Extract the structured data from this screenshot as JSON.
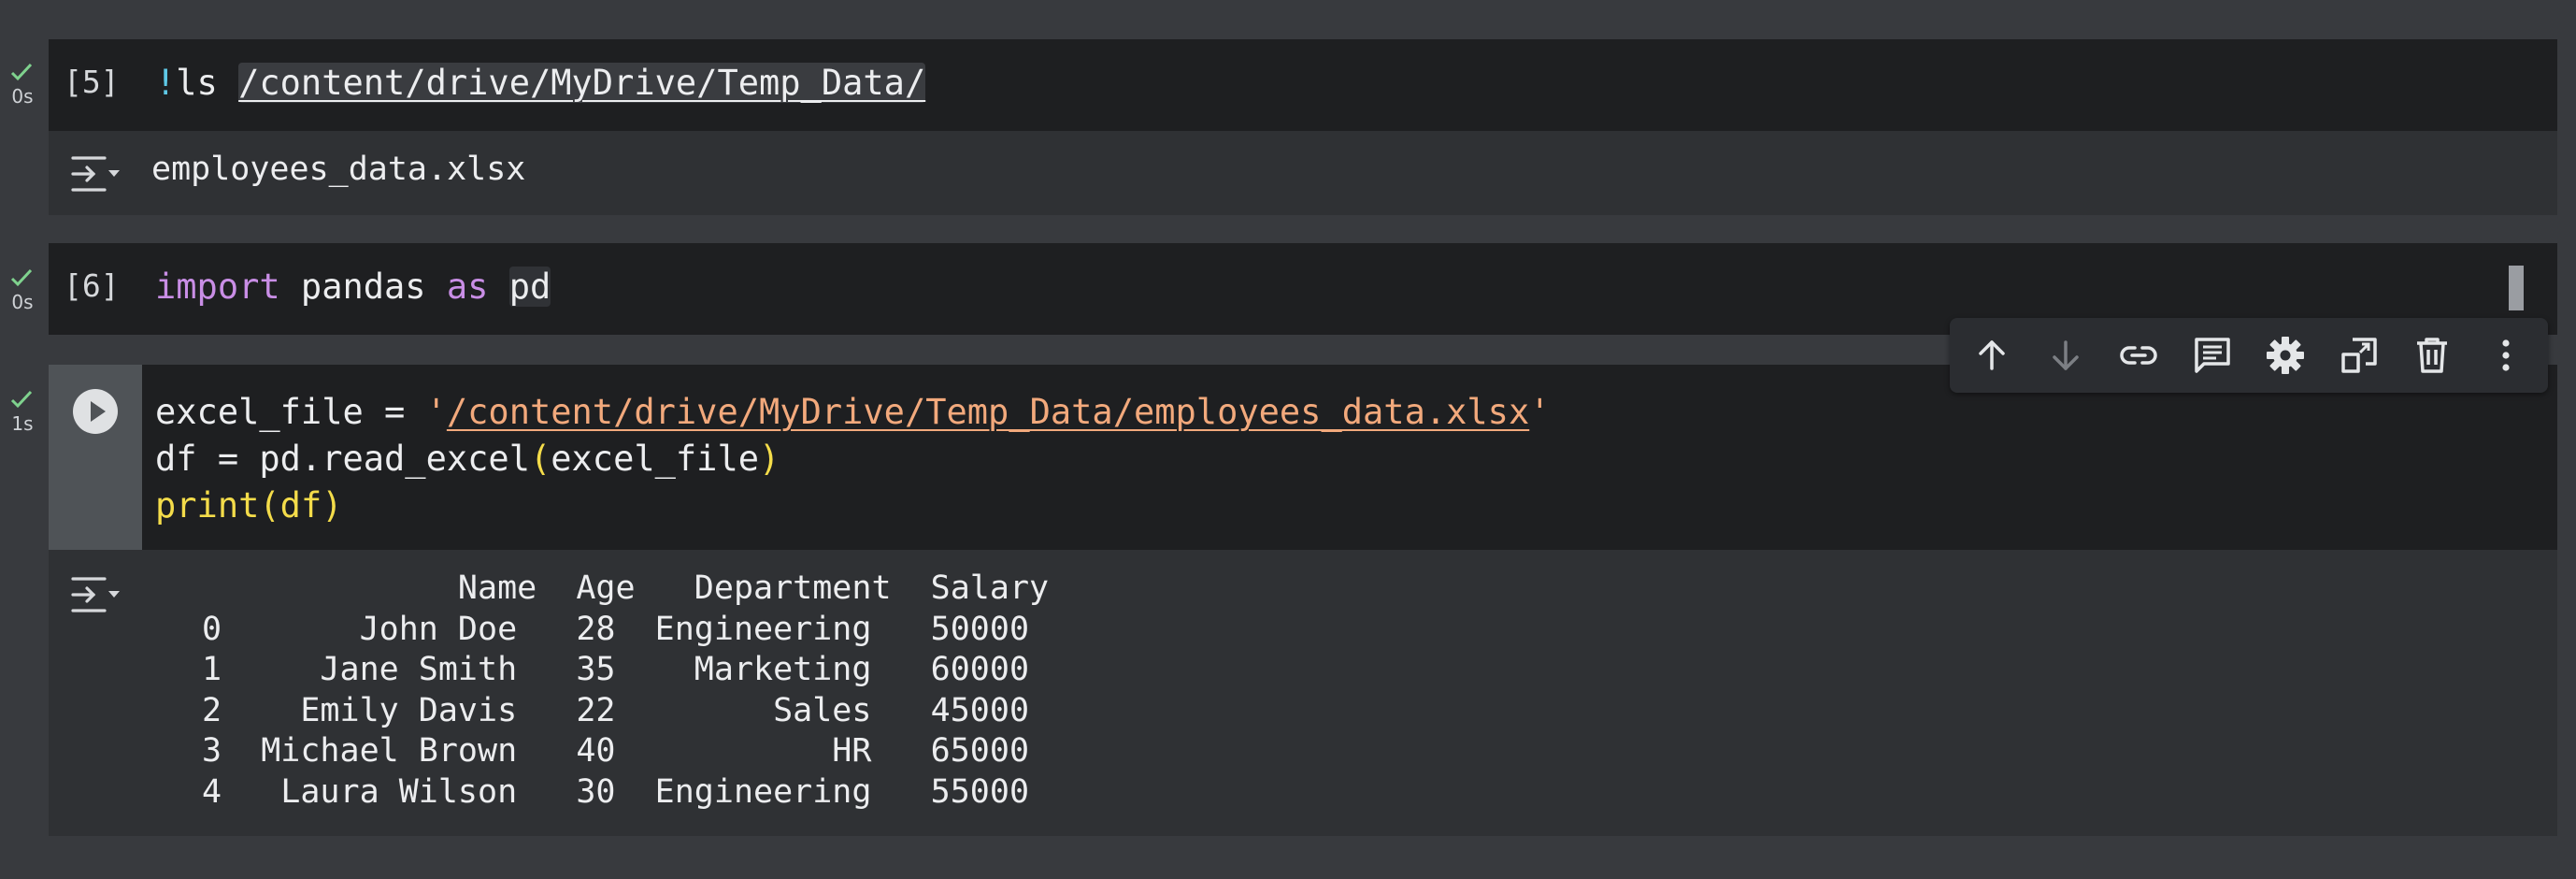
{
  "cells": [
    {
      "status_time": "0s",
      "exec_count": "[5]",
      "code_bang": "!",
      "code_cmd": "ls ",
      "code_path": "/content/drive/MyDrive/Temp_Data/",
      "output_lines": [
        "employees_data.xlsx"
      ]
    },
    {
      "status_time": "0s",
      "exec_count": "[6]",
      "code_kw1": "import",
      "code_mod": " pandas ",
      "code_kw2": "as",
      "code_space": " ",
      "code_alias": "pd"
    },
    {
      "status_time": "1s",
      "line1_a": "excel_file = ",
      "line1_q1": "'",
      "line1_path": "/content/drive/MyDrive/Temp_Data/employees_data.xlsx",
      "line1_q2": "'",
      "line2_a": "df = pd.read_excel",
      "line2_p1": "(",
      "line2_b": "excel_file",
      "line2_p2": ")",
      "line3_a": "print",
      "line3_p1": "(",
      "line3_b": "df",
      "line3_p2": ")",
      "output_header": "             Name  Age   Department  Salary",
      "output_rows": [
        "0       John Doe   28  Engineering   50000",
        "1     Jane Smith   35    Marketing   60000",
        "2    Emily Davis   22        Sales   45000",
        "3  Michael Brown   40           HR   65000",
        "4   Laura Wilson   30  Engineering   55000"
      ]
    }
  ],
  "toolbar": {
    "icons": [
      "arrow-up-icon",
      "arrow-down-icon",
      "link-icon",
      "comment-icon",
      "gear-icon",
      "mirror-cell-icon",
      "trash-icon",
      "more-vert-icon"
    ]
  },
  "colors": {
    "page_bg": "#383a3e",
    "code_bg": "#1e1f21",
    "output_bg": "#2f3134",
    "check": "#7fd28e",
    "keyword": "#c98ee6",
    "string": "#f2a97c",
    "paren": "#f4dc4a",
    "bang": "#5ec8e6"
  }
}
